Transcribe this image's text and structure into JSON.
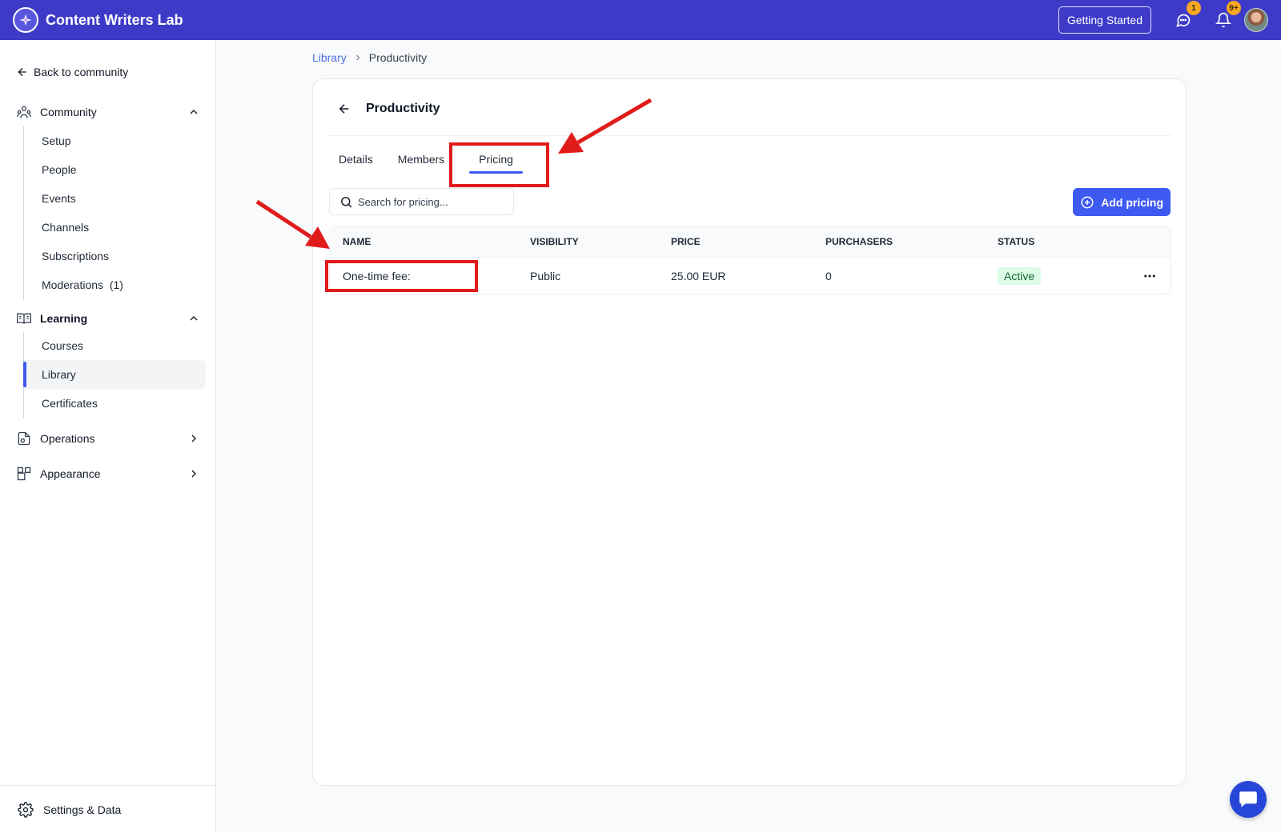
{
  "app": {
    "brand": "Content Writers Lab",
    "getting_started": "Getting Started",
    "messages_badge": "1",
    "notifications_badge": "9+"
  },
  "sidebar": {
    "back": "Back to community",
    "community": {
      "label": "Community",
      "items": [
        "Setup",
        "People",
        "Events",
        "Channels",
        "Subscriptions",
        "Moderations  (1)"
      ]
    },
    "learning": {
      "label": "Learning",
      "items": [
        "Courses",
        "Library",
        "Certificates"
      ]
    },
    "operations": "Operations",
    "appearance": "Appearance",
    "settings": "Settings & Data"
  },
  "breadcrumb": {
    "parent": "Library",
    "current": "Productivity"
  },
  "card": {
    "title": "Productivity",
    "tabs": [
      "Details",
      "Members",
      "Pricing"
    ],
    "search_placeholder": "Search for pricing...",
    "add_button": "Add pricing",
    "columns": [
      "NAME",
      "VISIBILITY",
      "PRICE",
      "PURCHASERS",
      "STATUS"
    ],
    "rows": [
      {
        "name": "One-time fee:",
        "visibility": "Public",
        "price": "25.00 EUR",
        "purchasers": "0",
        "status": "Active"
      }
    ]
  },
  "colors": {
    "topbar": "#3d3ac8",
    "accent": "#3d5af1",
    "annotation": "#e01b1b",
    "status_active_bg": "#dcfce7"
  }
}
